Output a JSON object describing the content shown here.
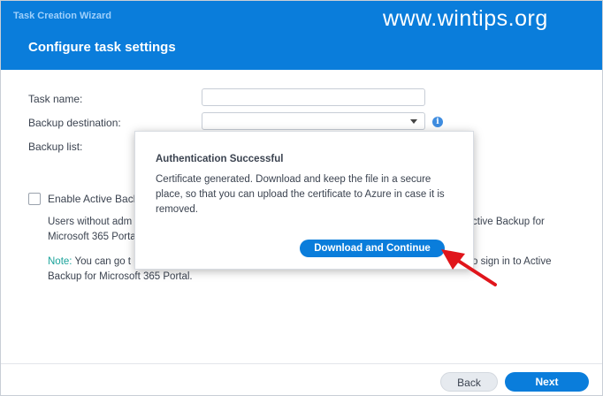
{
  "window": {
    "title": "Task Creation Wizard"
  },
  "watermark": "www.wintips.org",
  "page": {
    "title": "Configure task settings"
  },
  "form": {
    "task_name_label": "Task name:",
    "task_name_value": "",
    "backup_destination_label": "Backup destination:",
    "backup_destination_value": "",
    "backup_list_label": "Backup list:"
  },
  "active_backup": {
    "checkbox_label": "Enable Active Back",
    "checked": false,
    "desc_line1_left": "Users without adm",
    "desc_line1_right": "ctive Backup for",
    "desc_line2_left": "Microsoft 365 Porta",
    "note_label": "Note:",
    "note_line1_left": " You can go t",
    "note_line1_right": "o sign in to Active",
    "note_line2_left": "Backup for Microsoft 365 Portal."
  },
  "footer": {
    "back_label": "Back",
    "next_label": "Next"
  },
  "dialog": {
    "title": "Authentication Successful",
    "message": "Certificate generated. Download and keep the file in a secure place, so that you can upload the certificate to Azure in case it is removed.",
    "primary_button": "Download and Continue"
  },
  "icons": {
    "info": "info-icon",
    "dropdown": "chevron-down-icon",
    "annotation": "red-arrow-icon"
  },
  "colors": {
    "accent": "#0a7ddb",
    "note": "#1aa39b",
    "annotation": "#e0151b"
  }
}
